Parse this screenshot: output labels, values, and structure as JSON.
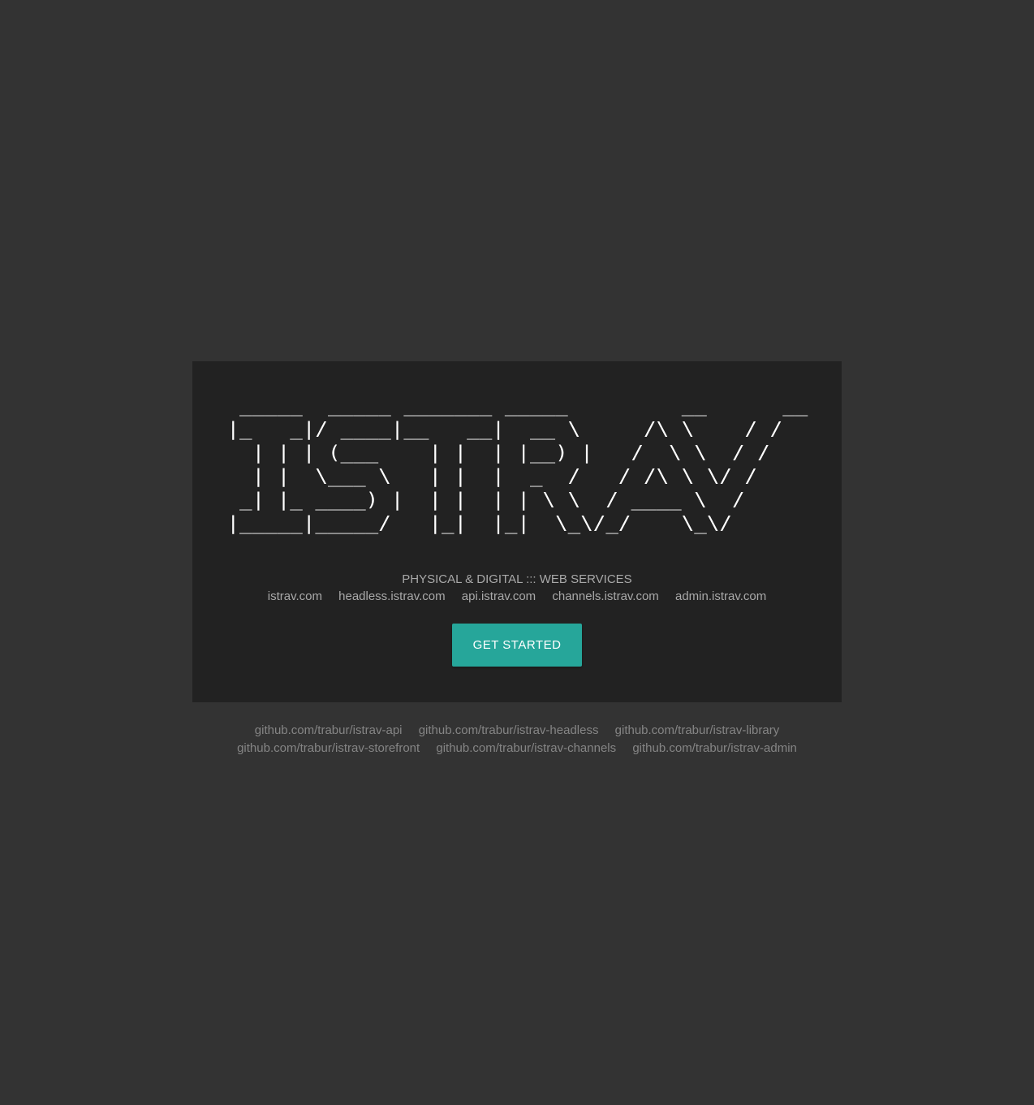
{
  "ascii_logo": " _____  _____ _______ _____         __      __\n|_   _|/ ____|__   __|  __ \\     /\\ \\    / /\n  | | | (___    | |  | |__) |   /  \\ \\  / / \n  | |  \\___ \\   | |  |  _  /   / /\\ \\ \\/ /  \n _| |_ ____) |  | |  | | \\ \\  / ____ \\  /   \n|_____|_____/   |_|  |_|  \\_\\/_/    \\_\\/    ",
  "tagline": "PHYSICAL & DIGITAL ::: WEB SERVICES",
  "domains": [
    "istrav.com",
    "headless.istrav.com",
    "api.istrav.com",
    "channels.istrav.com",
    "admin.istrav.com"
  ],
  "cta": {
    "label": "GET STARTED",
    "color": "#26a69a"
  },
  "footer_links": {
    "row1": [
      "github.com/trabur/istrav-api",
      "github.com/trabur/istrav-headless",
      "github.com/trabur/istrav-library"
    ],
    "row2": [
      "github.com/trabur/istrav-storefront",
      "github.com/trabur/istrav-channels",
      "github.com/trabur/istrav-admin"
    ]
  },
  "colors": {
    "background": "#333333",
    "card": "#222222",
    "muted_text": "#a9a9a9",
    "footer_text": "#858585"
  }
}
